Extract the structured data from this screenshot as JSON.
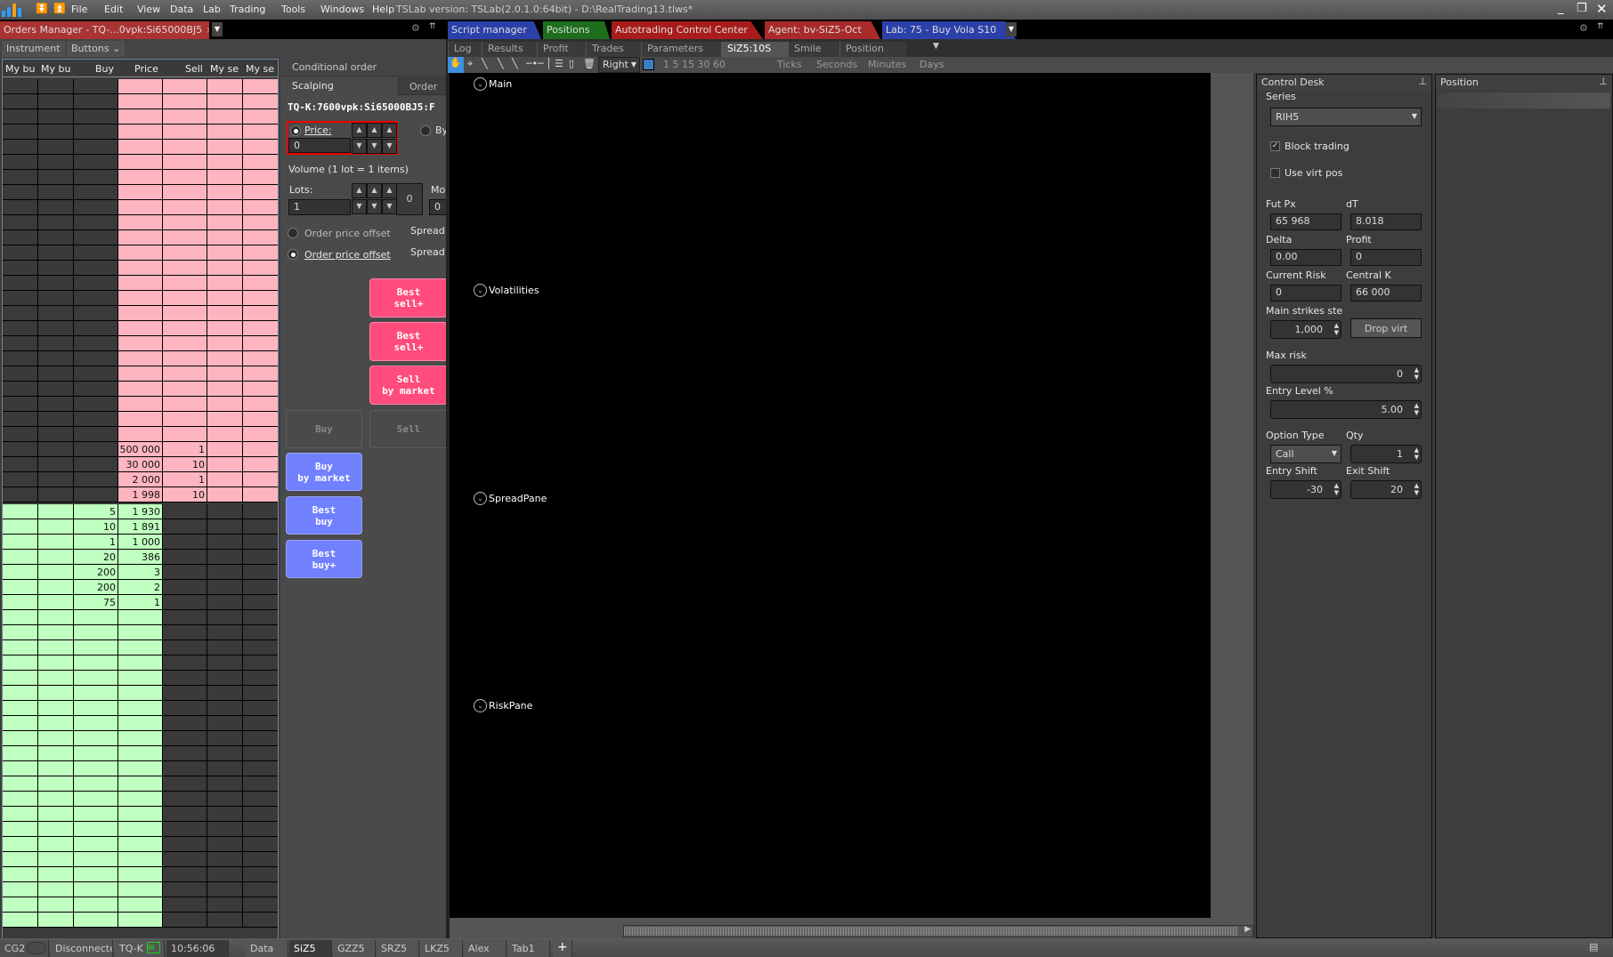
{
  "app": {
    "menu": [
      "File",
      "Edit",
      "View",
      "Data",
      "Lab",
      "Trading",
      "Tools",
      "Windows",
      "Help"
    ],
    "version": "TSLab version:  TSLab(2.0.1.0:64bit) - D:\\RealTrading13.tlws*"
  },
  "doc_tabs": {
    "left": "Orders Manager - TQ-...0vpk:Si65000BJ5",
    "right": [
      {
        "label": "Script manager",
        "color": "#2b40a8"
      },
      {
        "label": "Positions",
        "color": "#1e6e1e"
      },
      {
        "label": "Autotrading Control Center",
        "color": "#a81c1c"
      },
      {
        "label": "Agent: bv-SiZ5-Oct",
        "color": "#a82a2a"
      },
      {
        "label": "Lab: 75 - Buy Vola S10",
        "color": "#2b40a8"
      }
    ]
  },
  "left_toolbar": {
    "instrument": "Instrument",
    "buttons": "Buttons"
  },
  "order_book": {
    "headers": [
      "My bu",
      "My bu",
      "Buy",
      "Price",
      "Sell",
      "My se",
      "My se"
    ],
    "ask_rows_empty": 24,
    "asks": [
      {
        "price": "500 000",
        "sell": "1"
      },
      {
        "price": "30 000",
        "sell": "10"
      },
      {
        "price": "2 000",
        "sell": "1"
      },
      {
        "price": "1 998",
        "sell": "10"
      }
    ],
    "bids": [
      {
        "buy": "5",
        "price": "1 930"
      },
      {
        "buy": "10",
        "price": "1 891"
      },
      {
        "buy": "1",
        "price": "1 000"
      },
      {
        "buy": "20",
        "price": "386"
      },
      {
        "buy": "200",
        "price": "3"
      },
      {
        "buy": "200",
        "price": "2"
      },
      {
        "buy": "75",
        "price": "1"
      }
    ],
    "bid_rows_empty": 21
  },
  "cond": {
    "header": "Conditional order",
    "tab_scalping": "Scalping",
    "tab_order": "Order",
    "instrument": "TQ-K:7600vpk:Si65000BJ5:F",
    "price_label": "Price:",
    "price_value": "0",
    "by_label": "By",
    "volume": "Volume (1 lot = 1 items)",
    "lots_label": "Lots:",
    "lots_value": "1",
    "lots_extra": "0",
    "mo_label": "Mo",
    "mo_value": "0",
    "offset1": "Order price offset",
    "offset2": "Order price offset",
    "spread1": "Spread",
    "spread2": "Spread",
    "buttons": {
      "best_sell_1": "Best\nsell+",
      "best_sell_2": "Best\nsell+",
      "sell_market": "Sell\nby market",
      "buy": "Buy",
      "sell": "Sell",
      "buy_market": "Buy\nby market",
      "best_buy": "Best\nbuy",
      "best_buy_plus": "Best\nbuy+"
    }
  },
  "sub_tabs": [
    "Log",
    "Results",
    "Profit",
    "Trades",
    "Parameters",
    "SiZ5:10S",
    "Smile",
    "Position"
  ],
  "chart_toolbar": {
    "align": "Right",
    "intervals": "1 5 15 30 60",
    "units": [
      "Ticks",
      "Seconds",
      "Minutes",
      "Days"
    ]
  },
  "panes": [
    "Main",
    "Volatilities",
    "SpreadPane",
    "RiskPane"
  ],
  "control_desk": {
    "title": "Control Desk",
    "series_label": "Series",
    "series": "RIH5",
    "block_trading": "Block trading",
    "block_checked": true,
    "use_virt": "Use virt pos",
    "use_virt_checked": false,
    "fut_px_label": "Fut Px",
    "fut_px": "65 968",
    "dt_label": "dT",
    "dt": "8.018",
    "delta_label": "Delta",
    "delta": "0.00",
    "profit_label": "Profit",
    "profit": "0",
    "risk_label": "Current Risk",
    "risk": "0",
    "central_label": "Central K",
    "central": "66 000",
    "strikes_label": "Main strikes ste",
    "strikes": "1,000",
    "drop_virt": "Drop virt",
    "max_risk_label": "Max risk",
    "max_risk": "0",
    "entry_label": "Entry Level %",
    "entry": "5.00",
    "opt_type_label": "Option Type",
    "opt_type": "Call",
    "qty_label": "Qty",
    "qty": "1",
    "entry_shift_label": "Entry Shift",
    "entry_shift": "-30",
    "exit_shift_label": "Exit Shift",
    "exit_shift": "20"
  },
  "position_panel": {
    "title": "Position"
  },
  "status": {
    "cg": "CG2",
    "conn": "Disconnected",
    "tq": "TQ-K",
    "time": "10:56:06",
    "tabs": [
      "Data",
      "SiZ5",
      "GZZ5",
      "SRZ5",
      "LKZ5",
      "Alex",
      "Tab1"
    ],
    "add": "+"
  }
}
